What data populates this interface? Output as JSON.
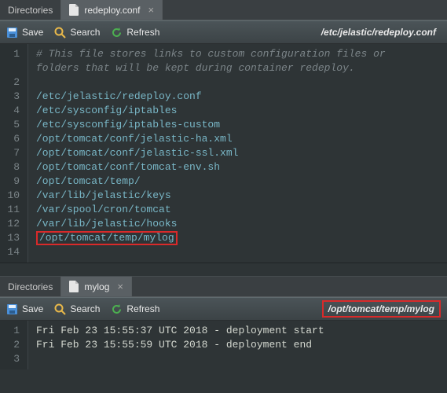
{
  "pane1": {
    "tabs": {
      "directories": "Directories",
      "file": "redeploy.conf"
    },
    "toolbar": {
      "save": "Save",
      "search": "Search",
      "refresh": "Refresh",
      "path": "/etc/jelastic/redeploy.conf"
    },
    "comment1": "# This file stores links to custom configuration files or",
    "comment2": "folders that will be kept during container redeploy.",
    "lines": [
      "/etc/jelastic/redeploy.conf",
      "/etc/sysconfig/iptables",
      "/etc/sysconfig/iptables-custom",
      "/opt/tomcat/conf/jelastic-ha.xml",
      "/opt/tomcat/conf/jelastic-ssl.xml",
      "/opt/tomcat/conf/tomcat-env.sh",
      "/opt/tomcat/temp/",
      "/var/lib/jelastic/keys",
      "/var/spool/cron/tomcat",
      "/var/lib/jelastic/hooks"
    ],
    "highlighted": "/opt/tomcat/temp/mylog",
    "lineNumbers": [
      "1",
      "",
      "2",
      "3",
      "4",
      "5",
      "6",
      "7",
      "8",
      "9",
      "10",
      "11",
      "12",
      "13",
      "14"
    ]
  },
  "pane2": {
    "tabs": {
      "directories": "Directories",
      "file": "mylog"
    },
    "toolbar": {
      "save": "Save",
      "search": "Search",
      "refresh": "Refresh",
      "path": "/opt/tomcat/temp/mylog"
    },
    "lines": [
      "Fri Feb 23 15:55:37 UTC 2018 - deployment start",
      "Fri Feb 23 15:55:59 UTC 2018 - deployment end"
    ],
    "lineNumbers": [
      "1",
      "2",
      "3"
    ]
  }
}
